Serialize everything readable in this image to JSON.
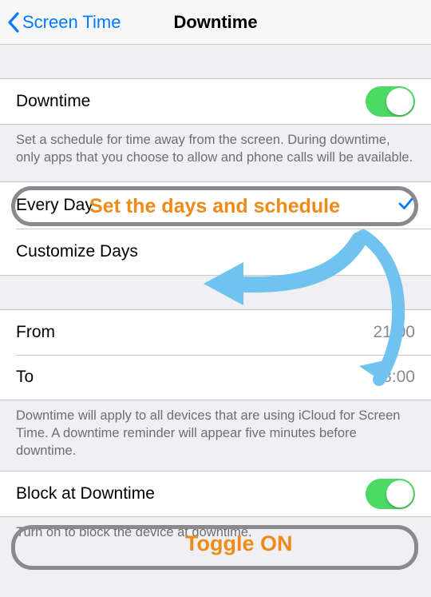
{
  "nav": {
    "back_label": "Screen Time",
    "title": "Downtime"
  },
  "section1": {
    "label": "Downtime",
    "toggle_on": true,
    "footer": "Set a schedule for time away from the screen. During downtime, only apps that you choose to allow and phone calls will be available."
  },
  "section2": {
    "every_day": "Every Day",
    "customize_days": "Customize Days"
  },
  "section3": {
    "from_label": "From",
    "from_value": "21:00",
    "to_label": "To",
    "to_value": "08:00",
    "footer": "Downtime will apply to all devices that are using iCloud for Screen Time. A downtime reminder will appear five minutes before downtime."
  },
  "section4": {
    "label": "Block at Downtime",
    "toggle_on": true,
    "footer": "Turn on to block the device at downtime."
  },
  "annotations": {
    "schedule": "Set the days and schedule",
    "toggle": "Toggle ON"
  }
}
